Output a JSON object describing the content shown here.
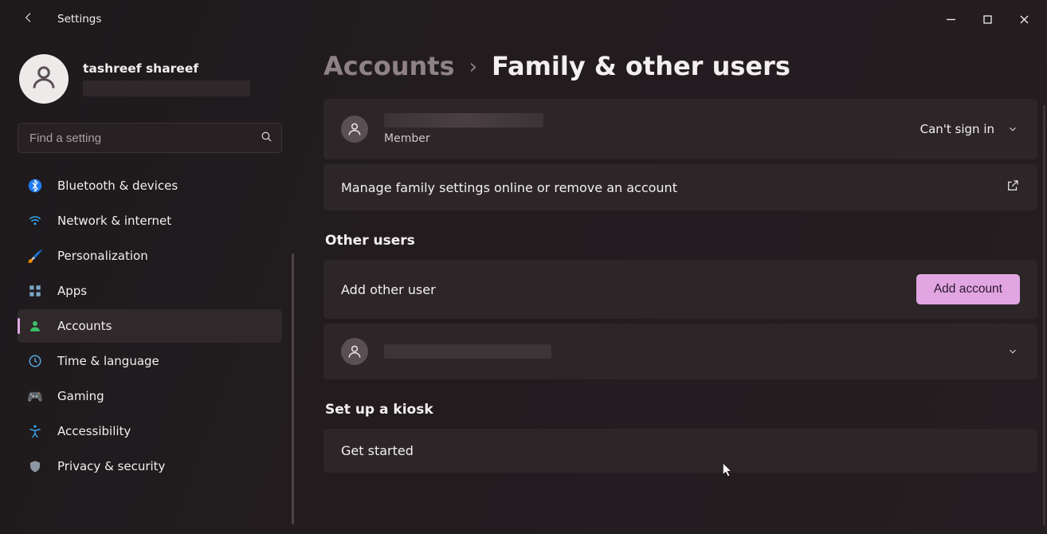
{
  "titlebar": {
    "app_title": "Settings"
  },
  "profile": {
    "name": "tashreef shareef"
  },
  "search": {
    "placeholder": "Find a setting"
  },
  "sidebar": {
    "items": [
      {
        "label": "Bluetooth & devices",
        "icon": "bluetooth-icon",
        "active": false
      },
      {
        "label": "Network & internet",
        "icon": "wifi-icon",
        "active": false
      },
      {
        "label": "Personalization",
        "icon": "brush-icon",
        "active": false
      },
      {
        "label": "Apps",
        "icon": "apps-icon",
        "active": false
      },
      {
        "label": "Accounts",
        "icon": "person-icon",
        "active": true
      },
      {
        "label": "Time & language",
        "icon": "time-lang-icon",
        "active": false
      },
      {
        "label": "Gaming",
        "icon": "gamepad-icon",
        "active": false
      },
      {
        "label": "Accessibility",
        "icon": "accessibility-icon",
        "active": false
      },
      {
        "label": "Privacy & security",
        "icon": "shield-icon",
        "active": false
      }
    ]
  },
  "breadcrumb": {
    "parent": "Accounts",
    "child": "Family & other users"
  },
  "family_member": {
    "role": "Member",
    "status": "Can't sign in"
  },
  "manage_card": {
    "text": "Manage family settings online or remove an account"
  },
  "section_other_users": {
    "title": "Other users"
  },
  "add_user": {
    "text": "Add other user",
    "button": "Add account"
  },
  "section_kiosk": {
    "title": "Set up a kiosk"
  },
  "kiosk_card": {
    "text": "Get started"
  }
}
